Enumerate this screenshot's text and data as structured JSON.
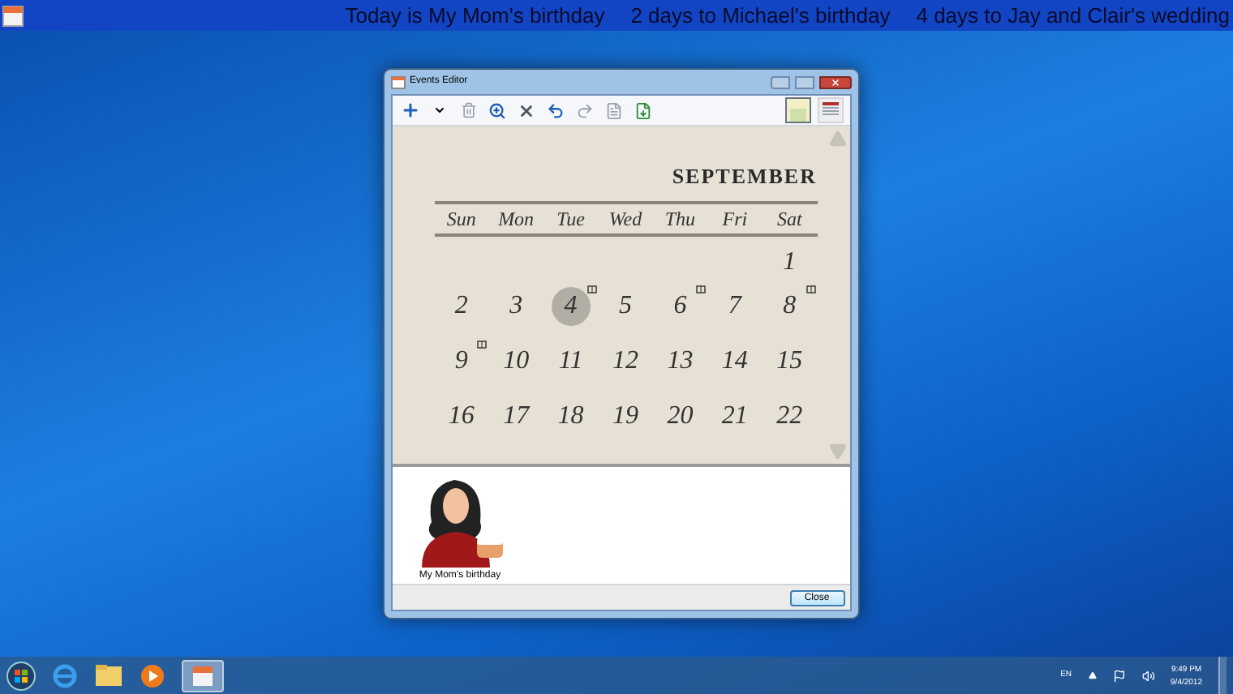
{
  "ticker": [
    "Today is My Mom's birthday",
    "2 days to Michael's birthday",
    "4 days to Jay and Clair's wedding"
  ],
  "window": {
    "title": "Events Editor"
  },
  "calendar": {
    "month": "SEPTEMBER",
    "weekdays": [
      "Sun",
      "Mon",
      "Tue",
      "Wed",
      "Thu",
      "Fri",
      "Sat"
    ],
    "weeks": [
      [
        {
          "day": "1",
          "selected": false,
          "has_event": false
        }
      ],
      [
        {
          "day": "2",
          "selected": false,
          "has_event": false
        },
        {
          "day": "3",
          "selected": false,
          "has_event": false
        },
        {
          "day": "4",
          "selected": true,
          "has_event": true
        },
        {
          "day": "5",
          "selected": false,
          "has_event": false
        },
        {
          "day": "6",
          "selected": false,
          "has_event": true
        },
        {
          "day": "7",
          "selected": false,
          "has_event": false
        },
        {
          "day": "8",
          "selected": false,
          "has_event": true
        }
      ],
      [
        {
          "day": "9",
          "selected": false,
          "has_event": true
        },
        {
          "day": "10",
          "selected": false,
          "has_event": false
        },
        {
          "day": "11",
          "selected": false,
          "has_event": false
        },
        {
          "day": "12",
          "selected": false,
          "has_event": false
        },
        {
          "day": "13",
          "selected": false,
          "has_event": false
        },
        {
          "day": "14",
          "selected": false,
          "has_event": false
        },
        {
          "day": "15",
          "selected": false,
          "has_event": false
        }
      ],
      [
        {
          "day": "16",
          "selected": false,
          "has_event": false
        },
        {
          "day": "17",
          "selected": false,
          "has_event": false
        },
        {
          "day": "18",
          "selected": false,
          "has_event": false
        },
        {
          "day": "19",
          "selected": false,
          "has_event": false
        },
        {
          "day": "20",
          "selected": false,
          "has_event": false
        },
        {
          "day": "21",
          "selected": false,
          "has_event": false
        },
        {
          "day": "22",
          "selected": false,
          "has_event": false
        }
      ]
    ]
  },
  "events": [
    {
      "label": "My Mom's birthday"
    }
  ],
  "close_button": "Close",
  "tray": {
    "language": "EN",
    "time": "9:49 PM",
    "date": "9/4/2012"
  }
}
